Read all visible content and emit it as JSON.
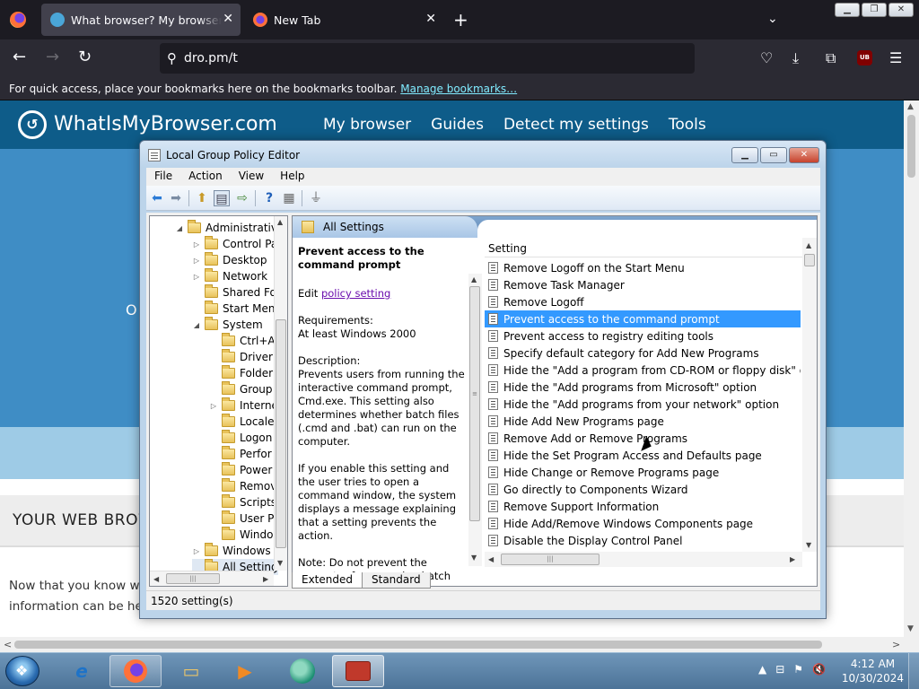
{
  "browser": {
    "tabs": [
      {
        "title": "What browser? My browser? Is",
        "close": "✕"
      },
      {
        "title": "New Tab",
        "close": "✕"
      }
    ],
    "new_tab": "+",
    "tab_list": "⌄",
    "url": "dro.pm/t",
    "bookmarks_msg": "For quick access, place your bookmarks here on the bookmarks toolbar.",
    "bookmarks_link": "Manage bookmarks…",
    "ublock_label": "UB"
  },
  "website": {
    "brand": "WhatIsMyBrowser.com",
    "nav": [
      "My browser",
      "Guides",
      "Detect my settings",
      "Tools"
    ],
    "hero_fragment": "O",
    "section_title": "YOUR WEB BROW",
    "para_lines": [
      "Now that you know wh",
      "information can be help"
    ]
  },
  "gpe": {
    "title": "Local Group Policy Editor",
    "menu": [
      "File",
      "Action",
      "View",
      "Help"
    ],
    "tree": [
      {
        "label": "Administrativ",
        "indent": 0,
        "exp": "◢"
      },
      {
        "label": "Control Pa",
        "indent": 1,
        "exp": "▷"
      },
      {
        "label": "Desktop",
        "indent": 1,
        "exp": "▷"
      },
      {
        "label": "Network",
        "indent": 1,
        "exp": "▷"
      },
      {
        "label": "Shared Fol",
        "indent": 1,
        "exp": ""
      },
      {
        "label": "Start Menu",
        "indent": 1,
        "exp": ""
      },
      {
        "label": "System",
        "indent": 1,
        "exp": "◢"
      },
      {
        "label": "Ctrl+A",
        "indent": 2,
        "exp": ""
      },
      {
        "label": "Driver",
        "indent": 2,
        "exp": ""
      },
      {
        "label": "Folder",
        "indent": 2,
        "exp": ""
      },
      {
        "label": "Group",
        "indent": 2,
        "exp": ""
      },
      {
        "label": "Interne",
        "indent": 2,
        "exp": "▷"
      },
      {
        "label": "Locale",
        "indent": 2,
        "exp": ""
      },
      {
        "label": "Logon",
        "indent": 2,
        "exp": ""
      },
      {
        "label": "Perfor",
        "indent": 2,
        "exp": ""
      },
      {
        "label": "Power",
        "indent": 2,
        "exp": ""
      },
      {
        "label": "Remov",
        "indent": 2,
        "exp": ""
      },
      {
        "label": "Scripts",
        "indent": 2,
        "exp": ""
      },
      {
        "label": "User Pr",
        "indent": 2,
        "exp": ""
      },
      {
        "label": "Windo",
        "indent": 2,
        "exp": ""
      },
      {
        "label": "Windows",
        "indent": 1,
        "exp": "▷"
      },
      {
        "label": "All Setting",
        "indent": 1,
        "exp": "",
        "selected": true
      }
    ],
    "pane_header": "All Settings",
    "desc": {
      "title": "Prevent access to the command prompt",
      "edit_prefix": "Edit ",
      "edit_link": "policy setting ",
      "requirements_label": "Requirements:",
      "requirements": "At least Windows 2000",
      "description_label": "Description:",
      "description": "Prevents users from running the interactive command prompt, Cmd.exe. This setting also determines whether batch files (.cmd and .bat) can run on the computer.",
      "enable_text": "If you enable this setting and the user tries to open a command window, the system displays a message explaining that a setting prevents the action.",
      "note": "Note: Do not prevent the computer from running batch"
    },
    "column_header": "Setting",
    "settings": [
      "Remove Logoff on the Start Menu",
      "Remove Task Manager",
      "Remove Logoff",
      "Prevent access to the command prompt",
      "Prevent access to registry editing tools",
      "Specify default category for Add New Programs",
      "Hide the \"Add a program from CD-ROM or floppy disk\" opti...",
      "Hide the \"Add programs from Microsoft\" option",
      "Hide the \"Add programs from your network\" option",
      "Hide Add New Programs page",
      "Remove Add or Remove Programs",
      "Hide the Set Program Access and Defaults page",
      "Hide Change or Remove Programs page",
      "Go directly to Components Wizard",
      "Remove Support Information",
      "Hide Add/Remove Windows Components page",
      "Disable the Display Control Panel"
    ],
    "selected_index": 3,
    "view_tabs": [
      "Extended",
      "Standard"
    ],
    "status": "1520 setting(s)"
  },
  "taskbar": {
    "time": "4:12 AM",
    "date": "10/30/2024"
  },
  "colors": {
    "selection": "#3399ff",
    "site_header": "#0e5c89"
  }
}
